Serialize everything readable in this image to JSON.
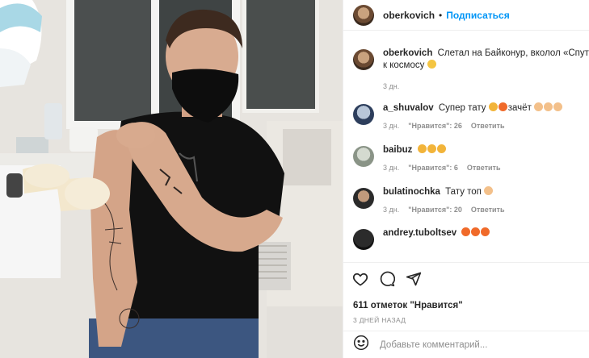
{
  "post": {
    "author": "oberkovich",
    "separator": "•",
    "follow_label": "Подписаться"
  },
  "caption": {
    "username": "oberkovich",
    "line1": "Слетал на Байконур, вколол «Спутник",
    "line2": "к космосу",
    "emoji": "grinning-face-emoji",
    "time": "3 дн."
  },
  "comments": [
    {
      "username": "a_shuvalov",
      "text": "Супер тату",
      "tail": "зачёт",
      "emojis": [
        "clapping-hands-emoji",
        "fire-emoji",
        "thumbs-up-emoji",
        "thumbs-up-emoji",
        "thumbs-up-emoji"
      ],
      "time": "3 дн.",
      "likes": "\"Нравится\": 26",
      "reply": "Ответить"
    },
    {
      "username": "baibuz",
      "text": "",
      "emojis": [
        "clapping-hands-emoji",
        "clapping-hands-emoji",
        "clapping-hands-emoji"
      ],
      "time": "3 дн.",
      "likes": "\"Нравится\": 6",
      "reply": "Ответить"
    },
    {
      "username": "bulatinochka",
      "text": "Тату топ",
      "emojis": [
        "thumbs-up-emoji"
      ],
      "time": "3 дн.",
      "likes": "\"Нравится\": 20",
      "reply": "Ответить"
    },
    {
      "username": "andrey.tuboltsev",
      "text": "",
      "emojis": [
        "fire-emoji",
        "fire-emoji",
        "fire-emoji"
      ]
    }
  ],
  "actions": {
    "likes_count": "611 отметок \"Нравится\"",
    "posted_ago": "3 ДНЕЙ НАЗАД",
    "comment_placeholder": "Добавьте комментарий..."
  },
  "icons": {
    "like": "heart-icon",
    "comment": "comment-icon",
    "share": "share-icon",
    "emoji": "smiley-icon"
  },
  "colors": {
    "link": "#0095f6",
    "muted": "#8e8e8e",
    "text": "#262626",
    "divider": "#efefef"
  }
}
